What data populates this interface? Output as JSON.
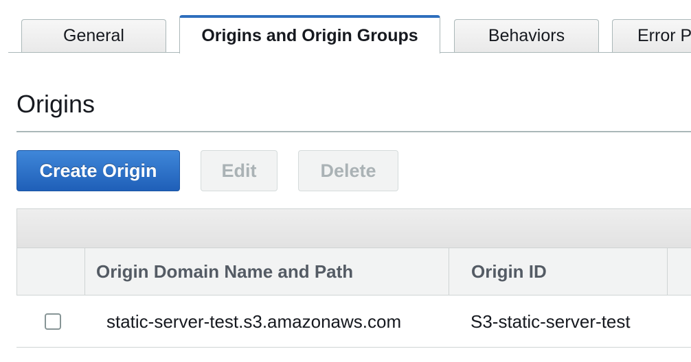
{
  "tabs": [
    {
      "label": "General",
      "active": false
    },
    {
      "label": "Origins and Origin Groups",
      "active": true
    },
    {
      "label": "Behaviors",
      "active": false
    },
    {
      "label": "Error P",
      "active": false
    }
  ],
  "section": {
    "title": "Origins"
  },
  "toolbar": {
    "create_label": "Create Origin",
    "edit_label": "Edit",
    "delete_label": "Delete"
  },
  "table": {
    "columns": [
      "Origin Domain Name and Path",
      "Origin ID"
    ],
    "rows": [
      {
        "selected": false,
        "domain": "static-server-test.s3.amazonaws.com",
        "origin_id": "S3-static-server-test"
      }
    ]
  },
  "colors": {
    "active_tab_accent": "#2e6fbd",
    "primary_button": "#2a6fc9",
    "disabled_text": "#aab2b5"
  }
}
